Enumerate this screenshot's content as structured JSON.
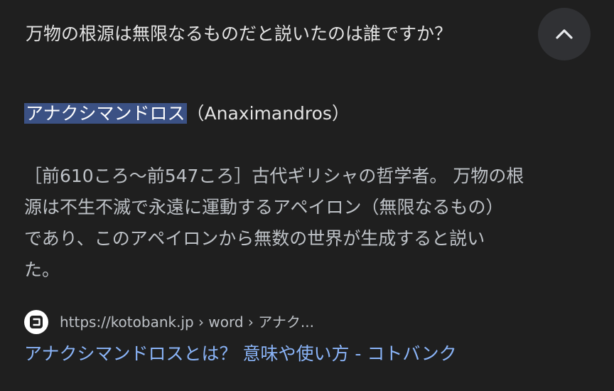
{
  "question": {
    "text": "万物の根源は無限なるものだと説いたのは誰ですか？",
    "collapse_icon": "chevron-up-icon"
  },
  "answer": {
    "highlight": "アナクシマンドロス",
    "rest": "（Anaximandros）"
  },
  "description": {
    "lines": [
      "［前610ころ〜前547ころ］古代ギリシャの哲学者。 万物の根",
      "源は不生不滅で永遠に運動するアペイロン（無限なるもの）",
      "であり、このアペイロンから無数の世界が生成すると説い",
      "た。"
    ]
  },
  "source": {
    "favicon": "kotobank-favicon",
    "url": "https://kotobank.jp › word › アナク..."
  },
  "result": {
    "title": "アナクシマンドロスとは？ 意味や使い方 - コトバンク"
  },
  "colors": {
    "background": "#1f1f1f",
    "highlight": "#3b5184",
    "link": "#8ab4f8",
    "button": "#303134"
  }
}
